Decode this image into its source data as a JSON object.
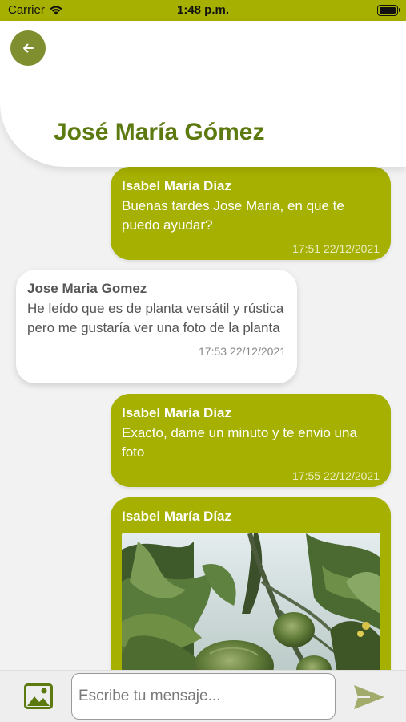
{
  "status_bar": {
    "carrier": "Carrier",
    "time": "1:48 p.m."
  },
  "header": {
    "title": "José María Gómez",
    "back_icon": "arrow-left-icon"
  },
  "messages": [
    {
      "direction": "out",
      "sender": "Isabel María Díaz",
      "text": "Buenas tardes Jose Maria, en que te puedo ayudar?",
      "time": "17:51 22/12/2021"
    },
    {
      "direction": "in",
      "sender": "Jose Maria  Gomez",
      "text": "He leído que es de planta versátil y rústica pero me gustaría ver una foto de la planta",
      "time": "17:53 22/12/2021"
    },
    {
      "direction": "out",
      "sender": "Isabel María Díaz",
      "text": "Exacto, dame un minuto y te envio una foto",
      "time": "17:55 22/12/2021"
    },
    {
      "direction": "out",
      "sender": "Isabel María Díaz",
      "image": "tomato-plant-photo"
    }
  ],
  "input_bar": {
    "placeholder": "Escribe tu mensaje...",
    "value": "",
    "gallery_icon": "image-gallery-icon",
    "send_icon": "send-icon"
  },
  "colors": {
    "accent": "#a6b000",
    "title": "#5c7a10",
    "back_button": "#7f8f30"
  }
}
